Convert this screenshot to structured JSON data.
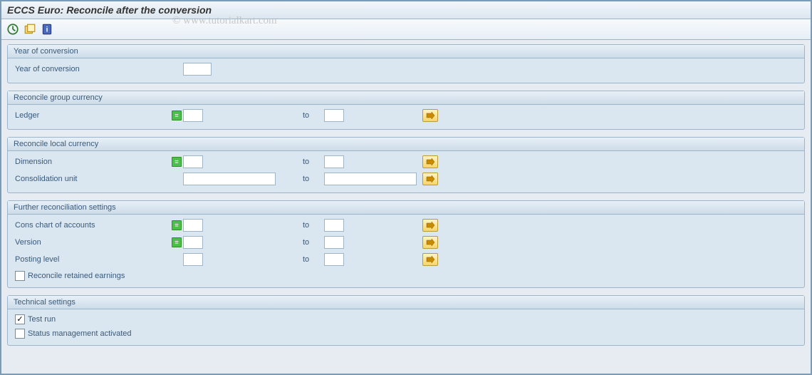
{
  "title": "ECCS Euro: Reconcile after the conversion",
  "watermark": "© www.tutorialkart.com",
  "groups": {
    "year": {
      "header": "Year of conversion",
      "label": "Year of conversion",
      "value": ""
    },
    "grpCurrency": {
      "header": "Reconcile group currency",
      "ledger": {
        "label": "Ledger",
        "to": "to",
        "from_val": "",
        "to_val": ""
      }
    },
    "localCurrency": {
      "header": "Reconcile local currency",
      "dimension": {
        "label": "Dimension",
        "to": "to",
        "from_val": "",
        "to_val": ""
      },
      "consUnit": {
        "label": "Consolidation unit",
        "to": "to",
        "from_val": "",
        "to_val": ""
      }
    },
    "further": {
      "header": "Further reconciliation settings",
      "consChart": {
        "label": "Cons chart of accounts",
        "to": "to",
        "from_val": "",
        "to_val": ""
      },
      "version": {
        "label": "Version",
        "to": "to",
        "from_val": "",
        "to_val": ""
      },
      "postingLevel": {
        "label": "Posting level",
        "to": "to",
        "from_val": "",
        "to_val": ""
      },
      "reconcileRetained": {
        "label": "Reconcile retained earnings",
        "checked": false
      }
    },
    "technical": {
      "header": "Technical settings",
      "testRun": {
        "label": "Test run",
        "checked": true
      },
      "statusMgmt": {
        "label": "Status management activated",
        "checked": false
      }
    }
  }
}
